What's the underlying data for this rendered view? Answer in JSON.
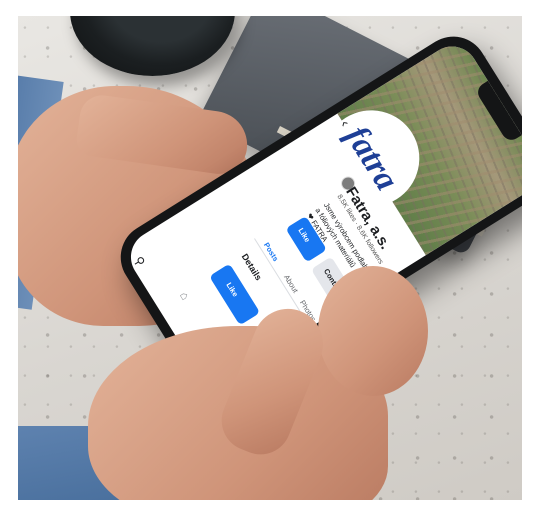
{
  "scene": {
    "description_objects": [
      "hands",
      "smartphone",
      "notebook",
      "cup"
    ],
    "colors": {
      "brand_blue": "#1e3f96",
      "facebook_blue": "#1877f2",
      "sleeve": "#5b80ad"
    }
  },
  "phone": {
    "logo_text": "fatra",
    "page_name": "Fatra, a.s.",
    "stats": "8.5K likes · 8.6K followers",
    "description_lines": [
      "Jsme výrobcem podlahových",
      "a fóliových materiálů",
      "❤ FATRA"
    ],
    "buttons": {
      "like": "Like",
      "contact": "Contact us"
    },
    "tabs": [
      "Posts",
      "About",
      "Photos"
    ],
    "details_heading": "Details",
    "icons": {
      "back": "back-arrow-icon",
      "search": "search-icon",
      "home": "home-icon",
      "menu": "menu-icon"
    }
  }
}
